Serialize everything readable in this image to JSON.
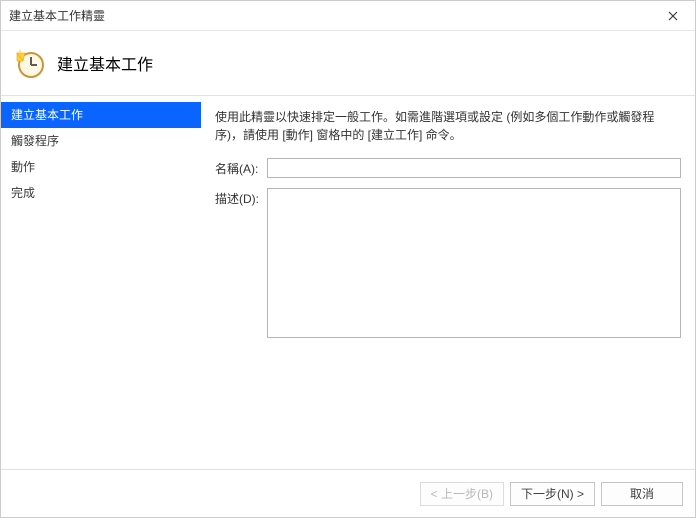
{
  "window": {
    "title": "建立基本工作精靈"
  },
  "header": {
    "title": "建立基本工作"
  },
  "sidebar": {
    "items": [
      {
        "label": "建立基本工作",
        "active": true
      },
      {
        "label": "觸發程序",
        "active": false
      },
      {
        "label": "動作",
        "active": false
      },
      {
        "label": "完成",
        "active": false
      }
    ]
  },
  "main": {
    "intro": "使用此精靈以快速排定一般工作。如需進階選項或設定 (例如多個工作動作或觸發程序)，請使用 [動作] 窗格中的 [建立工作] 命令。",
    "name_label": "名稱(A):",
    "name_value": "",
    "desc_label": "描述(D):",
    "desc_value": ""
  },
  "footer": {
    "back": "< 上一步(B)",
    "next": "下一步(N) >",
    "cancel": "取消"
  }
}
